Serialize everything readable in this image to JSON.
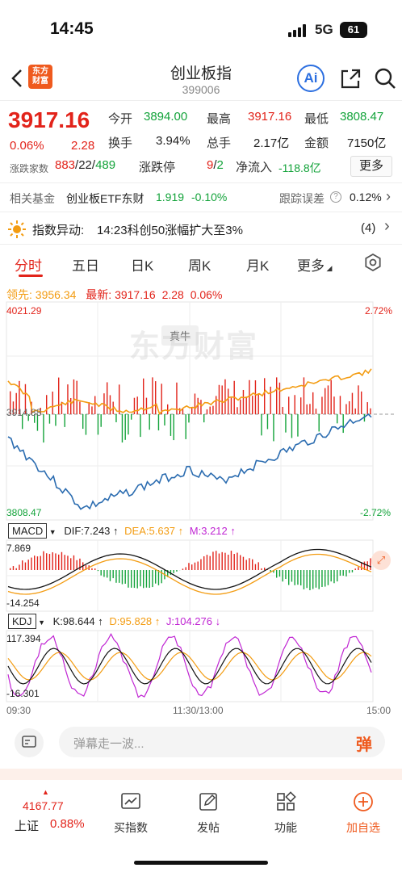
{
  "status": {
    "time": "14:45",
    "network": "5G",
    "battery": "61"
  },
  "header": {
    "title": "创业板指",
    "code": "399006",
    "logo_text": "东方财富",
    "ai_label": "Ai"
  },
  "quote": {
    "price": "3917.16",
    "pct": "0.06%",
    "change": "2.28",
    "open_label": "今开",
    "open": "3894.00",
    "high_label": "最高",
    "high": "3917.16",
    "low_label": "最低",
    "low": "3808.47",
    "turnover_label": "换手",
    "turnover": "3.94%",
    "volume_label": "总手",
    "volume": "2.17亿",
    "amount_label": "金额",
    "amount": "7150亿",
    "updown_label": "涨跌家数",
    "up_count": "883",
    "flat_count": "22",
    "down_count": "489",
    "limit_label": "涨跌停",
    "limit_up": "9",
    "limit_down": "2",
    "inflow_label": "净流入",
    "inflow": "-118.8亿",
    "more": "更多"
  },
  "fund": {
    "label": "相关基金",
    "name": "创业板ETF东财",
    "value": "1.919",
    "pct": "-0.10%",
    "track_label": "跟踪误差",
    "track": "0.12%"
  },
  "alert": {
    "label": "指数异动:",
    "text": "14:23科创50涨幅扩大至3%",
    "count": "(4)"
  },
  "tabs": [
    "分时",
    "五日",
    "日K",
    "周K",
    "月K",
    "更多"
  ],
  "chart_info": {
    "lead_label": "领先:",
    "lead": "3956.34",
    "latest_label": "最新:",
    "latest": "3917.16",
    "change": "2.28",
    "pct": "0.06%"
  },
  "chart_data": {
    "type": "line",
    "y_top": "4021.29",
    "y_mid": "3914.88",
    "y_bottom": "3808.47",
    "pct_top": "2.72%",
    "pct_bottom": "-2.72%",
    "watermark": "东方财富",
    "badge": "真牛",
    "x_labels": [
      "09:30",
      "11:30/13:00",
      "15:00"
    ],
    "ylim": [
      3808.47,
      4021.29
    ]
  },
  "macd": {
    "label": "MACD",
    "dif": "DIF:7.243 ↑",
    "dea": "DEA:5.637 ↑",
    "m": "M:3.212 ↑",
    "top": "7.869",
    "bottom": "-14.254"
  },
  "kdj": {
    "label": "KDJ",
    "k": "K:98.644 ↑",
    "d": "D:95.828 ↑",
    "j": "J:104.276 ↓",
    "top": "117.394",
    "bottom": "-16.301"
  },
  "comment": {
    "placeholder": "弹幕走一波...",
    "button": "弹"
  },
  "bottom": {
    "index_name": "上证",
    "index_value": "4167.77",
    "index_pct": "0.88%",
    "items": [
      "买指数",
      "发帖",
      "功能",
      "加自选"
    ]
  },
  "colors": {
    "up": "#e2231a",
    "down": "#13a33a",
    "price_line": "#2b6cb0",
    "avg_line": "#f39c12",
    "accent": "#ef5a1e"
  }
}
